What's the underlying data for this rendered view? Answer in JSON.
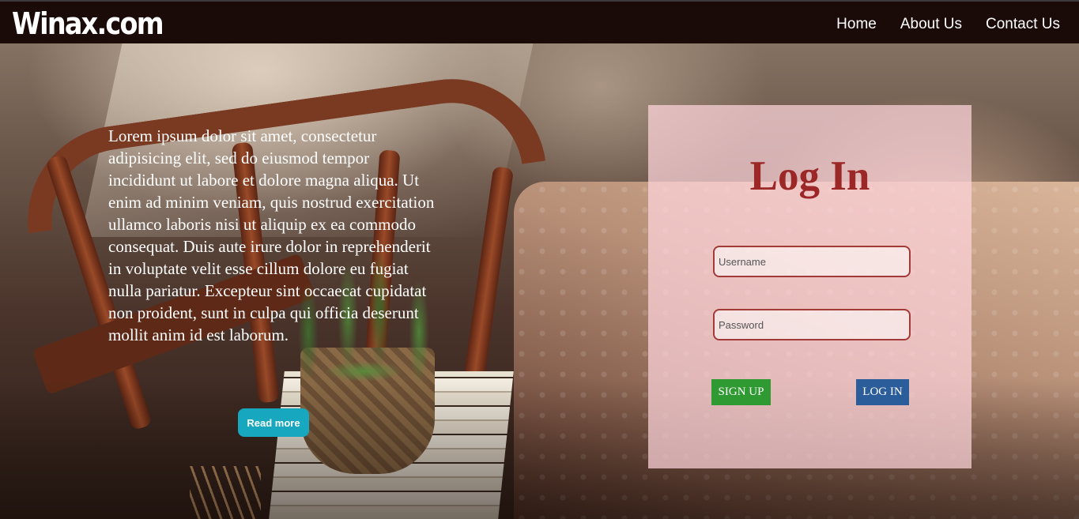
{
  "brand": {
    "name": "Winax.com"
  },
  "nav": {
    "items": [
      {
        "label": "Home"
      },
      {
        "label": "About Us"
      },
      {
        "label": "Contact Us"
      }
    ]
  },
  "intro": {
    "text": "Lorem ipsum dolor sit amet, consectetur adipisicing elit, sed do eiusmod tempor incididunt ut labore et dolore magna aliqua. Ut enim ad minim veniam, quis nostrud exercitation ullamco laboris nisi ut aliquip ex ea commodo consequat. Duis aute irure dolor in reprehenderit in voluptate velit esse cillum dolore eu fugiat nulla pariatur. Excepteur sint occaecat cupidatat non proident, sunt in culpa qui officia deserunt mollit anim id est laborum.",
    "read_more_label": "Read more"
  },
  "login": {
    "title": "Log In",
    "username_placeholder": "Username",
    "username_value": "",
    "password_placeholder": "Password",
    "password_value": "",
    "signup_label": "SIGN UP",
    "login_label": "LOG IN"
  },
  "colors": {
    "navbar_bg": "#1a0a08",
    "title_red": "#9b2727",
    "read_more_teal": "#17a7bf",
    "signup_green": "#2f9a32",
    "login_blue": "#2a5d9a"
  }
}
